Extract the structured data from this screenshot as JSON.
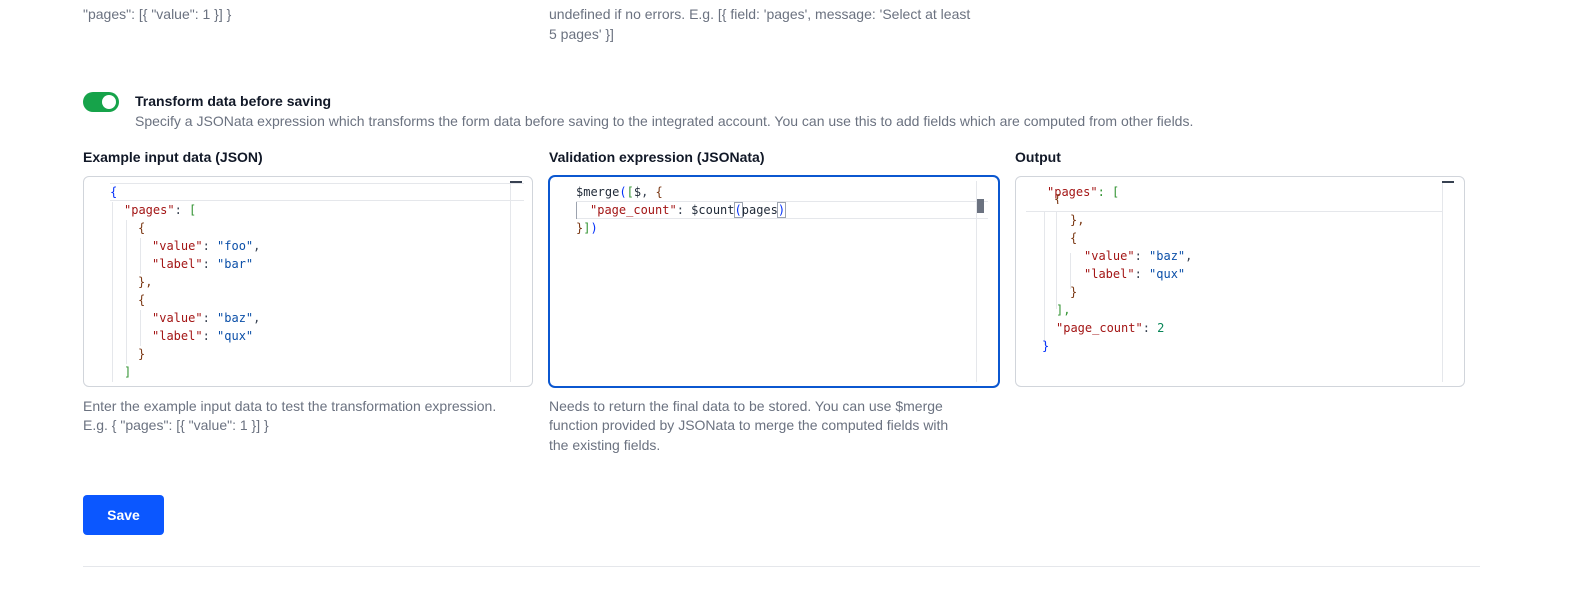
{
  "top": {
    "left_help_tail": "\"pages\": [{ \"value\": 1 }] }",
    "right_help_line1": "undefined if no errors. E.g. [{ field: 'pages', message: 'Select at least",
    "right_help_line2": "5 pages' }]"
  },
  "transform": {
    "toggle_on": true,
    "title": "Transform data before saving",
    "description": "Specify a JSONata expression which transforms the form data before saving to the integrated account. You can use this to add fields which are computed from other fields."
  },
  "input_editor": {
    "label": "Example input data (JSON)",
    "help_line1": "Enter the example input data to test the transformation expression.",
    "help_line2": "E.g. { \"pages\": [{ \"value\": 1 }] }",
    "code": {
      "open_brace": "{",
      "pages_key": "\"pages\"",
      "colon": ": ",
      "open_bracket": "[",
      "obj_open": "{",
      "value_key": "\"value\"",
      "label_key": "\"label\"",
      "val_foo": "\"foo\"",
      "label_bar": "\"bar\"",
      "comma": ",",
      "obj_close_comma": "},",
      "val_baz": "\"baz\"",
      "label_qux": "\"qux\"",
      "obj_close": "}",
      "close_bracket": "]"
    }
  },
  "expression_editor": {
    "label": "Validation expression (JSONata)",
    "help_line1": "Needs to return the final data to be stored. You can use $merge",
    "help_line2": "function provided by JSONata to merge the computed fields with",
    "help_line3": "the existing fields.",
    "code": {
      "merge_fn": "$merge",
      "open_paren": "(",
      "open_bracket": "[",
      "dollar": "$",
      "comma_space": ", ",
      "open_brace": "{",
      "page_count_key": "\"page_count\"",
      "colon": ": ",
      "count_fn": "$count",
      "paren_open": "(",
      "pages_arg": "pages",
      "paren_close": ")",
      "close_brace": "}",
      "close_bracket": "]",
      "close_paren": ")"
    }
  },
  "output_editor": {
    "label": "Output",
    "code": {
      "pages_key": "\"pages\"",
      "colon_bracket": ": [",
      "partial_brace": "{",
      "obj_close_comma": "},",
      "obj_open": "{",
      "value_key": "\"value\"",
      "label_key": "\"label\"",
      "colon": ": ",
      "val_baz": "\"baz\"",
      "label_qux": "\"qux\"",
      "comma": ",",
      "obj_close": "}",
      "close_bracket_comma": "],",
      "page_count_key": "\"page_count\"",
      "page_count_value": "2",
      "close_brace": "}"
    }
  },
  "actions": {
    "save_label": "Save"
  },
  "colors": {
    "toggle_on": "#16a34a",
    "primary_button": "#0b57ff",
    "focus_border": "#0b57d0"
  }
}
